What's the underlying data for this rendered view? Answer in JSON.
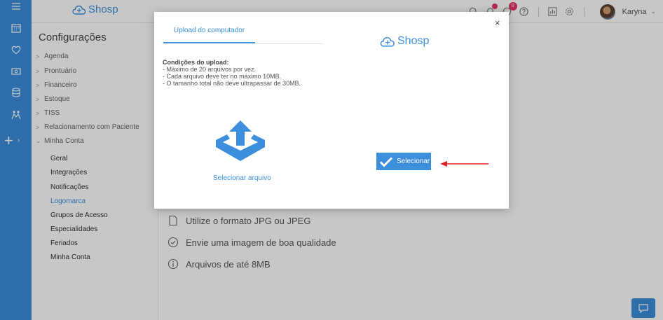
{
  "topbar": {
    "brand": "Shosp",
    "notifications_badge": "0",
    "user_name": "Karyna"
  },
  "sidebar": {
    "title": "Configurações",
    "categories": [
      {
        "label": "Agenda"
      },
      {
        "label": "Prontuário"
      },
      {
        "label": "Financeiro"
      },
      {
        "label": "Estoque"
      },
      {
        "label": "TISS"
      },
      {
        "label": "Relacionamento com Paciente"
      },
      {
        "label": "Minha Conta"
      }
    ],
    "subitems": [
      {
        "label": "Geral"
      },
      {
        "label": "Integrações"
      },
      {
        "label": "Notificações"
      },
      {
        "label": "Logomarca"
      },
      {
        "label": "Grupos de Acesso"
      },
      {
        "label": "Especialidades"
      },
      {
        "label": "Feriados"
      },
      {
        "label": "Minha Conta"
      }
    ]
  },
  "main": {
    "tips": [
      {
        "text": "Utilize o formato JPG ou JPEG"
      },
      {
        "text": "Envie uma imagem de boa qualidade"
      },
      {
        "text": "Arquivos de até 8MB"
      }
    ]
  },
  "modal": {
    "tab_label": "Upload do computador",
    "brand": "Shosp",
    "close_glyph": "×",
    "conditions_title": "Condições do upload:",
    "conditions": [
      "- Máximo de 20 arquivos por vez.",
      "- Cada arquivo deve ter no máximo 10MB.",
      "- O tamanho total não deve ultrapassar de 30MB."
    ],
    "select_file_label": "Selecionar arquivo",
    "select_button_label": "Selecionar"
  },
  "colors": {
    "accent": "#3c8fdc",
    "badge": "#e7346a",
    "annotation_arrow": "#e02020"
  }
}
